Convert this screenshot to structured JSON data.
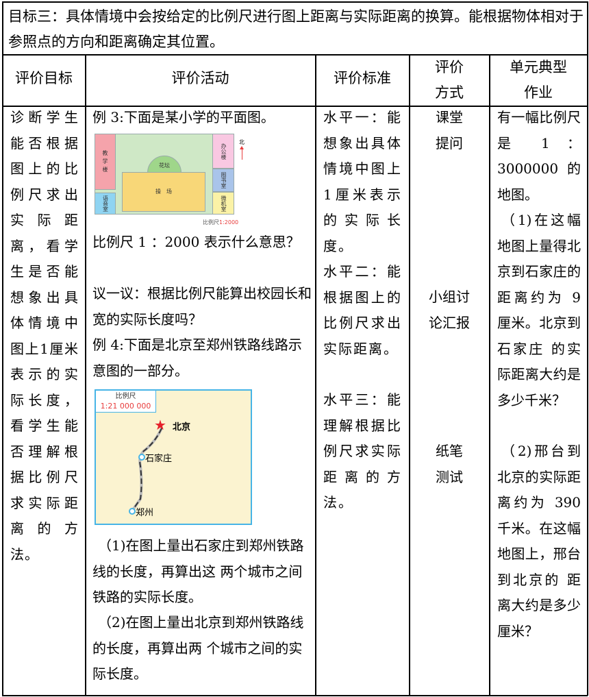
{
  "goal": "目标三：具体情境中会按给定的比例尺进行图上距离与实际距离的换算。能根据物体相对于参照点的方向和距离确定其位置。",
  "headers": [
    "评价目标",
    "评价活动",
    "评价标准",
    "评价\n方式",
    "单元典型\n作业"
  ],
  "headers_lines": {
    "method": [
      "评价",
      "方式"
    ],
    "homework": [
      "单元典型",
      "作业"
    ]
  },
  "col1": "诊断学生能否根据图上的比例尺求出实际距离，看学生是否能想象出具体情境中图上1厘米表示的实际长度，看学生能否理解根据比例尺求实际距离的方法。",
  "activity": {
    "example3": "例 3:下面是某小学的平面图。",
    "question1": "比例尺 1 ：2000 表示什么意思？",
    "discuss": "议一议：根据比例尺能算出校园长和宽的实际长度吗？",
    "example4": "例 4:下面是北京至郑州铁路线路示意图的一部分。",
    "task1": "（1)在图上量出石家庄到郑州铁路线的长度，再算出这 两个城市之间铁路的实际长度。",
    "task2": "（2)在图上量出北京到郑州铁路线的长度，再算出两 个城市之间的实际长度。"
  },
  "school_plan": {
    "north": "北",
    "scale_label": "比例尺",
    "scale_value": "1:2000",
    "areas": {
      "teaching": "教\n学\n楼",
      "language": "语音室",
      "flower": "花坛",
      "playground": "操　场",
      "office": "办公楼",
      "library": "图书室",
      "computer": "微机室"
    },
    "colors": {
      "ground": "#cfe8c6",
      "teaching": "#f5a3ab",
      "language": "#8fd4f2",
      "flower": "#9fd68a",
      "playground": "#f8d778",
      "office": "#f9c8e2",
      "library": "#a9c4ea",
      "computer": "#fbf2a6",
      "scale_red": "#e83c3c"
    }
  },
  "rail_map": {
    "scale_label": "比例尺",
    "scale_value": "1:21 000 000",
    "cities": [
      "北京",
      "石家庄",
      "郑州"
    ],
    "colors": {
      "bg": "#fbf3d0",
      "border": "#46b4e6",
      "star": "#e5202a",
      "scale": "#e83c3c",
      "dot": "#46b4e6"
    }
  },
  "standards": {
    "level1": "水平一：能想象出具体情境中图上1厘米表示的实际长度。",
    "level2": "水平二：能根据图上的比例尺求出实际距离。",
    "level3": "水平三：能理解根据比例尺求实际距离的方法。"
  },
  "methods": {
    "m1": [
      "课堂",
      "提问"
    ],
    "m2": [
      "小组讨",
      "论汇报"
    ],
    "m3": [
      "纸笔",
      "测试"
    ]
  },
  "homework": {
    "intro": "有一幅比例尺是 1 ：3000000 的地图。",
    "q1": "（1)在这幅地图上量得北京到石家庄的距离约为 9 厘米。北京到石家庄 的实际距离大约是多少千米？",
    "q2": "（2)邢台到北京的实际距离约为 390 千米。在这幅地图上，邢台到北京的 距离大约是多少厘米？"
  }
}
